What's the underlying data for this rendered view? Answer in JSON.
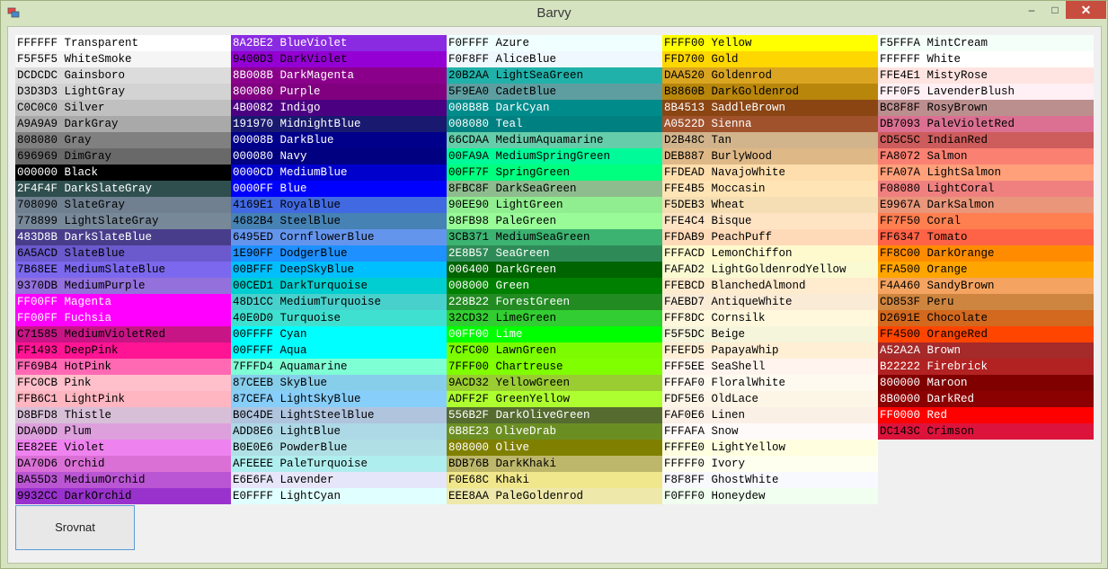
{
  "window": {
    "title": "Barvy",
    "minimize_glyph": "–",
    "maximize_glyph": "□",
    "close_glyph": "✕",
    "icon_name": "app-icon"
  },
  "sort_button": {
    "label": "Srovnat"
  },
  "columns": [
    [
      {
        "hex": "FFFFFF",
        "name": "Transparent",
        "bg": "#FFFFFF",
        "fg": "#000000"
      },
      {
        "hex": "F5F5F5",
        "name": "WhiteSmoke",
        "bg": "#F5F5F5",
        "fg": "#000000"
      },
      {
        "hex": "DCDCDC",
        "name": "Gainsboro",
        "bg": "#DCDCDC",
        "fg": "#000000"
      },
      {
        "hex": "D3D3D3",
        "name": "LightGray",
        "bg": "#D3D3D3",
        "fg": "#000000"
      },
      {
        "hex": "C0C0C0",
        "name": "Silver",
        "bg": "#C0C0C0",
        "fg": "#000000"
      },
      {
        "hex": "A9A9A9",
        "name": "DarkGray",
        "bg": "#A9A9A9",
        "fg": "#000000"
      },
      {
        "hex": "808080",
        "name": "Gray",
        "bg": "#808080",
        "fg": "#000000"
      },
      {
        "hex": "696969",
        "name": "DimGray",
        "bg": "#696969",
        "fg": "#000000"
      },
      {
        "hex": "000000",
        "name": "Black",
        "bg": "#000000",
        "fg": "#FFFFFF"
      },
      {
        "hex": "2F4F4F",
        "name": "DarkSlateGray",
        "bg": "#2F4F4F",
        "fg": "#FFFFFF"
      },
      {
        "hex": "708090",
        "name": "SlateGray",
        "bg": "#708090",
        "fg": "#000000"
      },
      {
        "hex": "778899",
        "name": "LightSlateGray",
        "bg": "#778899",
        "fg": "#000000"
      },
      {
        "hex": "483D8B",
        "name": "DarkSlateBlue",
        "bg": "#483D8B",
        "fg": "#FFFFFF"
      },
      {
        "hex": "6A5ACD",
        "name": "SlateBlue",
        "bg": "#6A5ACD",
        "fg": "#000000"
      },
      {
        "hex": "7B68EE",
        "name": "MediumSlateBlue",
        "bg": "#7B68EE",
        "fg": "#000000"
      },
      {
        "hex": "9370DB",
        "name": "MediumPurple",
        "bg": "#9370DB",
        "fg": "#000000"
      },
      {
        "hex": "FF00FF",
        "name": "Magenta",
        "bg": "#FF00FF",
        "fg": "#FFFFFF"
      },
      {
        "hex": "FF00FF",
        "name": "Fuchsia",
        "bg": "#FF00FF",
        "fg": "#FFFFFF"
      },
      {
        "hex": "C71585",
        "name": "MediumVioletRed",
        "bg": "#C71585",
        "fg": "#000000"
      },
      {
        "hex": "FF1493",
        "name": "DeepPink",
        "bg": "#FF1493",
        "fg": "#000000"
      },
      {
        "hex": "FF69B4",
        "name": "HotPink",
        "bg": "#FF69B4",
        "fg": "#000000"
      },
      {
        "hex": "FFC0CB",
        "name": "Pink",
        "bg": "#FFC0CB",
        "fg": "#000000"
      },
      {
        "hex": "FFB6C1",
        "name": "LightPink",
        "bg": "#FFB6C1",
        "fg": "#000000"
      },
      {
        "hex": "D8BFD8",
        "name": "Thistle",
        "bg": "#D8BFD8",
        "fg": "#000000"
      },
      {
        "hex": "DDA0DD",
        "name": "Plum",
        "bg": "#DDA0DD",
        "fg": "#000000"
      },
      {
        "hex": "EE82EE",
        "name": "Violet",
        "bg": "#EE82EE",
        "fg": "#000000"
      },
      {
        "hex": "DA70D6",
        "name": "Orchid",
        "bg": "#DA70D6",
        "fg": "#000000"
      },
      {
        "hex": "BA55D3",
        "name": "MediumOrchid",
        "bg": "#BA55D3",
        "fg": "#000000"
      },
      {
        "hex": "9932CC",
        "name": "DarkOrchid",
        "bg": "#9932CC",
        "fg": "#000000"
      }
    ],
    [
      {
        "hex": "8A2BE2",
        "name": "BlueViolet",
        "bg": "#8A2BE2",
        "fg": "#FFFFFF"
      },
      {
        "hex": "9400D3",
        "name": "DarkViolet",
        "bg": "#9400D3",
        "fg": "#000000"
      },
      {
        "hex": "8B008B",
        "name": "DarkMagenta",
        "bg": "#8B008B",
        "fg": "#FFFFFF"
      },
      {
        "hex": "800080",
        "name": "Purple",
        "bg": "#800080",
        "fg": "#FFFFFF"
      },
      {
        "hex": "4B0082",
        "name": "Indigo",
        "bg": "#4B0082",
        "fg": "#FFFFFF"
      },
      {
        "hex": "191970",
        "name": "MidnightBlue",
        "bg": "#191970",
        "fg": "#FFFFFF"
      },
      {
        "hex": "00008B",
        "name": "DarkBlue",
        "bg": "#00008B",
        "fg": "#FFFFFF"
      },
      {
        "hex": "000080",
        "name": "Navy",
        "bg": "#000080",
        "fg": "#FFFFFF"
      },
      {
        "hex": "0000CD",
        "name": "MediumBlue",
        "bg": "#0000CD",
        "fg": "#FFFFFF"
      },
      {
        "hex": "0000FF",
        "name": "Blue",
        "bg": "#0000FF",
        "fg": "#FFFFFF"
      },
      {
        "hex": "4169E1",
        "name": "RoyalBlue",
        "bg": "#4169E1",
        "fg": "#000000"
      },
      {
        "hex": "4682B4",
        "name": "SteelBlue",
        "bg": "#4682B4",
        "fg": "#000000"
      },
      {
        "hex": "6495ED",
        "name": "CornflowerBlue",
        "bg": "#6495ED",
        "fg": "#000000"
      },
      {
        "hex": "1E90FF",
        "name": "DodgerBlue",
        "bg": "#1E90FF",
        "fg": "#000000"
      },
      {
        "hex": "00BFFF",
        "name": "DeepSkyBlue",
        "bg": "#00BFFF",
        "fg": "#000000"
      },
      {
        "hex": "00CED1",
        "name": "DarkTurquoise",
        "bg": "#00CED1",
        "fg": "#000000"
      },
      {
        "hex": "48D1CC",
        "name": "MediumTurquoise",
        "bg": "#48D1CC",
        "fg": "#000000"
      },
      {
        "hex": "40E0D0",
        "name": "Turquoise",
        "bg": "#40E0D0",
        "fg": "#000000"
      },
      {
        "hex": "00FFFF",
        "name": "Cyan",
        "bg": "#00FFFF",
        "fg": "#000000"
      },
      {
        "hex": "00FFFF",
        "name": "Aqua",
        "bg": "#00FFFF",
        "fg": "#000000"
      },
      {
        "hex": "7FFFD4",
        "name": "Aquamarine",
        "bg": "#7FFFD4",
        "fg": "#000000"
      },
      {
        "hex": "87CEEB",
        "name": "SkyBlue",
        "bg": "#87CEEB",
        "fg": "#000000"
      },
      {
        "hex": "87CEFA",
        "name": "LightSkyBlue",
        "bg": "#87CEFA",
        "fg": "#000000"
      },
      {
        "hex": "B0C4DE",
        "name": "LightSteelBlue",
        "bg": "#B0C4DE",
        "fg": "#000000"
      },
      {
        "hex": "ADD8E6",
        "name": "LightBlue",
        "bg": "#ADD8E6",
        "fg": "#000000"
      },
      {
        "hex": "B0E0E6",
        "name": "PowderBlue",
        "bg": "#B0E0E6",
        "fg": "#000000"
      },
      {
        "hex": "AFEEEE",
        "name": "PaleTurquoise",
        "bg": "#AFEEEE",
        "fg": "#000000"
      },
      {
        "hex": "E6E6FA",
        "name": "Lavender",
        "bg": "#E6E6FA",
        "fg": "#000000"
      },
      {
        "hex": "E0FFFF",
        "name": "LightCyan",
        "bg": "#E0FFFF",
        "fg": "#000000"
      }
    ],
    [
      {
        "hex": "F0FFFF",
        "name": "Azure",
        "bg": "#F0FFFF",
        "fg": "#000000"
      },
      {
        "hex": "F0F8FF",
        "name": "AliceBlue",
        "bg": "#F0F8FF",
        "fg": "#000000"
      },
      {
        "hex": "20B2AA",
        "name": "LightSeaGreen",
        "bg": "#20B2AA",
        "fg": "#000000"
      },
      {
        "hex": "5F9EA0",
        "name": "CadetBlue",
        "bg": "#5F9EA0",
        "fg": "#000000"
      },
      {
        "hex": "008B8B",
        "name": "DarkCyan",
        "bg": "#008B8B",
        "fg": "#FFFFFF"
      },
      {
        "hex": "008080",
        "name": "Teal",
        "bg": "#008080",
        "fg": "#FFFFFF"
      },
      {
        "hex": "66CDAA",
        "name": "MediumAquamarine",
        "bg": "#66CDAA",
        "fg": "#000000"
      },
      {
        "hex": "00FA9A",
        "name": "MediumSpringGreen",
        "bg": "#00FA9A",
        "fg": "#000000"
      },
      {
        "hex": "00FF7F",
        "name": "SpringGreen",
        "bg": "#00FF7F",
        "fg": "#000000"
      },
      {
        "hex": "8FBC8F",
        "name": "DarkSeaGreen",
        "bg": "#8FBC8F",
        "fg": "#000000"
      },
      {
        "hex": "90EE90",
        "name": "LightGreen",
        "bg": "#90EE90",
        "fg": "#000000"
      },
      {
        "hex": "98FB98",
        "name": "PaleGreen",
        "bg": "#98FB98",
        "fg": "#000000"
      },
      {
        "hex": "3CB371",
        "name": "MediumSeaGreen",
        "bg": "#3CB371",
        "fg": "#000000"
      },
      {
        "hex": "2E8B57",
        "name": "SeaGreen",
        "bg": "#2E8B57",
        "fg": "#FFFFFF"
      },
      {
        "hex": "006400",
        "name": "DarkGreen",
        "bg": "#006400",
        "fg": "#FFFFFF"
      },
      {
        "hex": "008000",
        "name": "Green",
        "bg": "#008000",
        "fg": "#FFFFFF"
      },
      {
        "hex": "228B22",
        "name": "ForestGreen",
        "bg": "#228B22",
        "fg": "#FFFFFF"
      },
      {
        "hex": "32CD32",
        "name": "LimeGreen",
        "bg": "#32CD32",
        "fg": "#000000"
      },
      {
        "hex": "00FF00",
        "name": "Lime",
        "bg": "#00FF00",
        "fg": "#FFFFFF"
      },
      {
        "hex": "7CFC00",
        "name": "LawnGreen",
        "bg": "#7CFC00",
        "fg": "#000000"
      },
      {
        "hex": "7FFF00",
        "name": "Chartreuse",
        "bg": "#7FFF00",
        "fg": "#000000"
      },
      {
        "hex": "9ACD32",
        "name": "YellowGreen",
        "bg": "#9ACD32",
        "fg": "#000000"
      },
      {
        "hex": "ADFF2F",
        "name": "GreenYellow",
        "bg": "#ADFF2F",
        "fg": "#000000"
      },
      {
        "hex": "556B2F",
        "name": "DarkOliveGreen",
        "bg": "#556B2F",
        "fg": "#FFFFFF"
      },
      {
        "hex": "6B8E23",
        "name": "OliveDrab",
        "bg": "#6B8E23",
        "fg": "#FFFFFF"
      },
      {
        "hex": "808000",
        "name": "Olive",
        "bg": "#808000",
        "fg": "#FFFFFF"
      },
      {
        "hex": "BDB76B",
        "name": "DarkKhaki",
        "bg": "#BDB76B",
        "fg": "#000000"
      },
      {
        "hex": "F0E68C",
        "name": "Khaki",
        "bg": "#F0E68C",
        "fg": "#000000"
      },
      {
        "hex": "EEE8AA",
        "name": "PaleGoldenrod",
        "bg": "#EEE8AA",
        "fg": "#000000"
      }
    ],
    [
      {
        "hex": "FFFF00",
        "name": "Yellow",
        "bg": "#FFFF00",
        "fg": "#000000"
      },
      {
        "hex": "FFD700",
        "name": "Gold",
        "bg": "#FFD700",
        "fg": "#000000"
      },
      {
        "hex": "DAA520",
        "name": "Goldenrod",
        "bg": "#DAA520",
        "fg": "#000000"
      },
      {
        "hex": "B8860B",
        "name": "DarkGoldenrod",
        "bg": "#B8860B",
        "fg": "#000000"
      },
      {
        "hex": "8B4513",
        "name": "SaddleBrown",
        "bg": "#8B4513",
        "fg": "#FFFFFF"
      },
      {
        "hex": "A0522D",
        "name": "Sienna",
        "bg": "#A0522D",
        "fg": "#FFFFFF"
      },
      {
        "hex": "D2B48C",
        "name": "Tan",
        "bg": "#D2B48C",
        "fg": "#000000"
      },
      {
        "hex": "DEB887",
        "name": "BurlyWood",
        "bg": "#DEB887",
        "fg": "#000000"
      },
      {
        "hex": "FFDEAD",
        "name": "NavajoWhite",
        "bg": "#FFDEAD",
        "fg": "#000000"
      },
      {
        "hex": "FFE4B5",
        "name": "Moccasin",
        "bg": "#FFE4B5",
        "fg": "#000000"
      },
      {
        "hex": "F5DEB3",
        "name": "Wheat",
        "bg": "#F5DEB3",
        "fg": "#000000"
      },
      {
        "hex": "FFE4C4",
        "name": "Bisque",
        "bg": "#FFE4C4",
        "fg": "#000000"
      },
      {
        "hex": "FFDAB9",
        "name": "PeachPuff",
        "bg": "#FFDAB9",
        "fg": "#000000"
      },
      {
        "hex": "FFFACD",
        "name": "LemonChiffon",
        "bg": "#FFFACD",
        "fg": "#000000"
      },
      {
        "hex": "FAFAD2",
        "name": "LightGoldenrodYellow",
        "bg": "#FAFAD2",
        "fg": "#000000"
      },
      {
        "hex": "FFEBCD",
        "name": "BlanchedAlmond",
        "bg": "#FFEBCD",
        "fg": "#000000"
      },
      {
        "hex": "FAEBD7",
        "name": "AntiqueWhite",
        "bg": "#FAEBD7",
        "fg": "#000000"
      },
      {
        "hex": "FFF8DC",
        "name": "Cornsilk",
        "bg": "#FFF8DC",
        "fg": "#000000"
      },
      {
        "hex": "F5F5DC",
        "name": "Beige",
        "bg": "#F5F5DC",
        "fg": "#000000"
      },
      {
        "hex": "FFEFD5",
        "name": "PapayaWhip",
        "bg": "#FFEFD5",
        "fg": "#000000"
      },
      {
        "hex": "FFF5EE",
        "name": "SeaShell",
        "bg": "#FFF5EE",
        "fg": "#000000"
      },
      {
        "hex": "FFFAF0",
        "name": "FloralWhite",
        "bg": "#FFFAF0",
        "fg": "#000000"
      },
      {
        "hex": "FDF5E6",
        "name": "OldLace",
        "bg": "#FDF5E6",
        "fg": "#000000"
      },
      {
        "hex": "FAF0E6",
        "name": "Linen",
        "bg": "#FAF0E6",
        "fg": "#000000"
      },
      {
        "hex": "FFFAFA",
        "name": "Snow",
        "bg": "#FFFAFA",
        "fg": "#000000"
      },
      {
        "hex": "FFFFE0",
        "name": "LightYellow",
        "bg": "#FFFFE0",
        "fg": "#000000"
      },
      {
        "hex": "FFFFF0",
        "name": "Ivory",
        "bg": "#FFFFF0",
        "fg": "#000000"
      },
      {
        "hex": "F8F8FF",
        "name": "GhostWhite",
        "bg": "#F8F8FF",
        "fg": "#000000"
      },
      {
        "hex": "F0FFF0",
        "name": "Honeydew",
        "bg": "#F0FFF0",
        "fg": "#000000"
      }
    ],
    [
      {
        "hex": "F5FFFA",
        "name": "MintCream",
        "bg": "#F5FFFA",
        "fg": "#000000"
      },
      {
        "hex": "FFFFFF",
        "name": "White",
        "bg": "#FFFFFF",
        "fg": "#000000"
      },
      {
        "hex": "FFE4E1",
        "name": "MistyRose",
        "bg": "#FFE4E1",
        "fg": "#000000"
      },
      {
        "hex": "FFF0F5",
        "name": "LavenderBlush",
        "bg": "#FFF0F5",
        "fg": "#000000"
      },
      {
        "hex": "BC8F8F",
        "name": "RosyBrown",
        "bg": "#BC8F8F",
        "fg": "#000000"
      },
      {
        "hex": "DB7093",
        "name": "PaleVioletRed",
        "bg": "#DB7093",
        "fg": "#000000"
      },
      {
        "hex": "CD5C5C",
        "name": "IndianRed",
        "bg": "#CD5C5C",
        "fg": "#000000"
      },
      {
        "hex": "FA8072",
        "name": "Salmon",
        "bg": "#FA8072",
        "fg": "#000000"
      },
      {
        "hex": "FFA07A",
        "name": "LightSalmon",
        "bg": "#FFA07A",
        "fg": "#000000"
      },
      {
        "hex": "F08080",
        "name": "LightCoral",
        "bg": "#F08080",
        "fg": "#000000"
      },
      {
        "hex": "E9967A",
        "name": "DarkSalmon",
        "bg": "#E9967A",
        "fg": "#000000"
      },
      {
        "hex": "FF7F50",
        "name": "Coral",
        "bg": "#FF7F50",
        "fg": "#000000"
      },
      {
        "hex": "FF6347",
        "name": "Tomato",
        "bg": "#FF6347",
        "fg": "#000000"
      },
      {
        "hex": "FF8C00",
        "name": "DarkOrange",
        "bg": "#FF8C00",
        "fg": "#000000"
      },
      {
        "hex": "FFA500",
        "name": "Orange",
        "bg": "#FFA500",
        "fg": "#000000"
      },
      {
        "hex": "F4A460",
        "name": "SandyBrown",
        "bg": "#F4A460",
        "fg": "#000000"
      },
      {
        "hex": "CD853F",
        "name": "Peru",
        "bg": "#CD853F",
        "fg": "#000000"
      },
      {
        "hex": "D2691E",
        "name": "Chocolate",
        "bg": "#D2691E",
        "fg": "#000000"
      },
      {
        "hex": "FF4500",
        "name": "OrangeRed",
        "bg": "#FF4500",
        "fg": "#000000"
      },
      {
        "hex": "A52A2A",
        "name": "Brown",
        "bg": "#A52A2A",
        "fg": "#FFFFFF"
      },
      {
        "hex": "B22222",
        "name": "Firebrick",
        "bg": "#B22222",
        "fg": "#FFFFFF"
      },
      {
        "hex": "800000",
        "name": "Maroon",
        "bg": "#800000",
        "fg": "#FFFFFF"
      },
      {
        "hex": "8B0000",
        "name": "DarkRed",
        "bg": "#8B0000",
        "fg": "#FFFFFF"
      },
      {
        "hex": "FF0000",
        "name": "Red",
        "bg": "#FF0000",
        "fg": "#FFFFFF"
      },
      {
        "hex": "DC143C",
        "name": "Crimson",
        "bg": "#DC143C",
        "fg": "#000000"
      }
    ]
  ]
}
